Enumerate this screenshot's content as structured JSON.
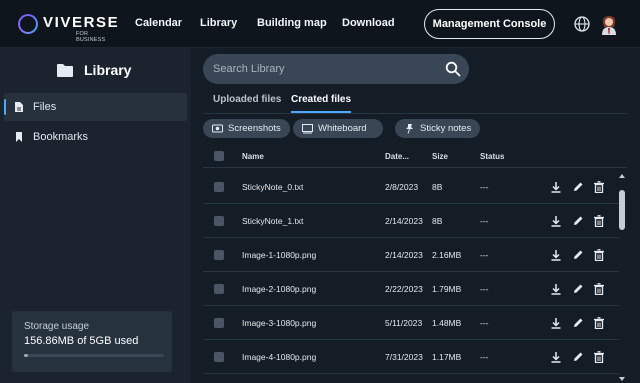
{
  "colors": {
    "accent": "#4aa8ff",
    "background": "#141c25",
    "sidebar": "#1a232e",
    "chip": "#394655"
  },
  "nav": {
    "brand": "VIVERSE",
    "brand_sub": "FOR BUSINESS",
    "links": [
      "Calendar",
      "Library",
      "Building map",
      "Download"
    ],
    "console_label": "Management Console",
    "icons": [
      "globe-icon",
      "user-avatar-icon"
    ]
  },
  "sidebar": {
    "title": "Library",
    "title_icon": "folder-icon",
    "items": [
      {
        "label": "Files",
        "icon": "file-icon",
        "active": true
      },
      {
        "label": "Bookmarks",
        "icon": "bookmark-icon",
        "active": false
      }
    ],
    "storage": {
      "label": "Storage usage",
      "value": "156.86MB of 5GB used",
      "fraction_used": 0.031
    }
  },
  "main": {
    "search": {
      "placeholder": "Search Library",
      "icon": "search-icon"
    },
    "tabs": [
      {
        "label": "Uploaded files",
        "active": false
      },
      {
        "label": "Created files",
        "active": true
      }
    ],
    "filters": [
      {
        "label": "Screenshots",
        "icon": "screenshot-icon"
      },
      {
        "label": "Whiteboard",
        "icon": "whiteboard-icon"
      },
      {
        "label": "Sticky notes",
        "icon": "pin-icon"
      }
    ],
    "table": {
      "headers": {
        "name": "Name",
        "date": "Date...",
        "size": "Size",
        "status": "Status"
      },
      "rows": [
        {
          "name": "StickyNote_0.txt",
          "date": "2/8/2023",
          "size": "8B",
          "status": "---"
        },
        {
          "name": "StickyNote_1.txt",
          "date": "2/14/2023",
          "size": "8B",
          "status": "---"
        },
        {
          "name": "Image-1-1080p.png",
          "date": "2/14/2023",
          "size": "2.16MB",
          "status": "---"
        },
        {
          "name": "Image-2-1080p.png",
          "date": "2/22/2023",
          "size": "1.79MB",
          "status": "---"
        },
        {
          "name": "Image-3-1080p.png",
          "date": "5/11/2023",
          "size": "1.48MB",
          "status": "---"
        },
        {
          "name": "Image-4-1080p.png",
          "date": "7/31/2023",
          "size": "1.17MB",
          "status": "---"
        }
      ],
      "row_actions": [
        "download-icon",
        "edit-icon",
        "delete-icon"
      ]
    }
  }
}
